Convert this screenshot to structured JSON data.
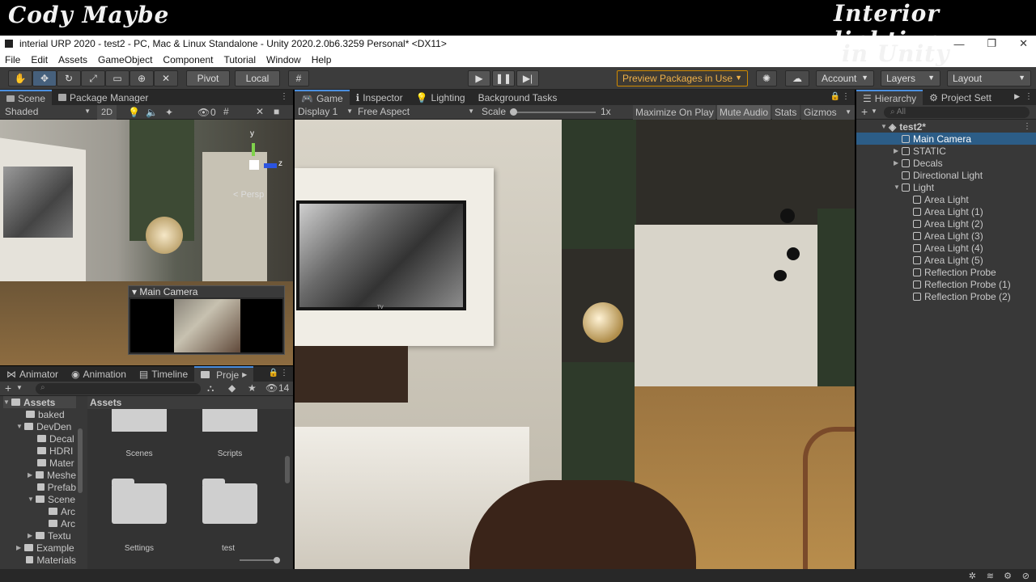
{
  "banner": {
    "left_title": "Cody Maybe",
    "right_title_line1": "Interior lighting",
    "right_title_line2": "in Unity"
  },
  "window": {
    "title": "interial URP 2020 - test2 - PC, Mac & Linux Standalone - Unity 2020.2.0b6.3259 Personal* <DX11>"
  },
  "menu": [
    "File",
    "Edit",
    "Assets",
    "GameObject",
    "Component",
    "Tutorial",
    "Window",
    "Help"
  ],
  "toolbar": {
    "pivot": "Pivot",
    "local": "Local",
    "preview_packages": "Preview Packages in Use",
    "account": "Account",
    "layers": "Layers",
    "layout": "Layout"
  },
  "scene_panel": {
    "tabs": [
      "Scene",
      "Package Manager"
    ],
    "shading": "Shaded",
    "mode_2d": "2D",
    "hidden_count": "0",
    "persp_label": "< Persp",
    "camera_preview_title": "Main Camera"
  },
  "game_panel": {
    "tabs": [
      "Game",
      "Inspector",
      "Lighting",
      "Background Tasks"
    ],
    "display": "Display 1",
    "aspect": "Free Aspect",
    "scale_label": "Scale",
    "scale_value": "1x",
    "maximize": "Maximize On Play",
    "mute": "Mute Audio",
    "stats": "Stats",
    "gizmos": "Gizmos",
    "tv_brand": "TV"
  },
  "hierarchy": {
    "tabs": [
      "Hierarchy",
      "Project Sett"
    ],
    "search_placeholder": "All",
    "root": "test2*",
    "items": [
      {
        "label": "Main Camera",
        "selected": true
      },
      {
        "label": "STATIC"
      },
      {
        "label": "Decals"
      },
      {
        "label": "Directional Light"
      },
      {
        "label": "Light"
      },
      {
        "label": "Area Light"
      },
      {
        "label": "Area Light (1)"
      },
      {
        "label": "Area Light (2)"
      },
      {
        "label": "Area Light (3)"
      },
      {
        "label": "Area Light (4)"
      },
      {
        "label": "Area Light (5)"
      },
      {
        "label": "Reflection Probe"
      },
      {
        "label": "Reflection Probe (1)"
      },
      {
        "label": "Reflection Probe (2)"
      }
    ]
  },
  "project_panel": {
    "tabs": [
      "Animator",
      "Animation",
      "Timeline",
      "Proje"
    ],
    "hidden_count": "14",
    "tree_root": "Assets",
    "tree": [
      "baked",
      "DevDen",
      "Decal",
      "HDRI",
      "Mater",
      "Meshe",
      "Prefab",
      "Scene",
      "Arc",
      "Arc",
      "Textu",
      "Example",
      "Materials"
    ],
    "grid_header": "Assets",
    "folders": [
      "Scenes",
      "Scripts",
      "Settings",
      "test"
    ]
  }
}
